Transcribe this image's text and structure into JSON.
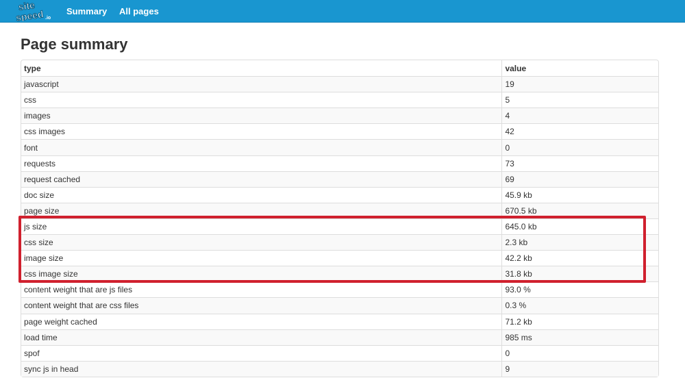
{
  "logo": {
    "text_top": "site",
    "text_bottom": "speed",
    "suffix": ".io"
  },
  "nav": {
    "summary": "Summary",
    "all_pages": "All pages"
  },
  "page_title": "Page summary",
  "table": {
    "headers": [
      "type",
      "value"
    ],
    "rows": [
      [
        "javascript",
        "19"
      ],
      [
        "css",
        "5"
      ],
      [
        "images",
        "4"
      ],
      [
        "css images",
        "42"
      ],
      [
        "font",
        "0"
      ],
      [
        "requests",
        "73"
      ],
      [
        "request cached",
        "69"
      ],
      [
        "doc size",
        "45.9 kb"
      ],
      [
        "page size",
        "670.5 kb"
      ],
      [
        "js size",
        "645.0 kb"
      ],
      [
        "css size",
        "2.3 kb"
      ],
      [
        "image size",
        "42.2 kb"
      ],
      [
        "css image size",
        "31.8 kb"
      ],
      [
        "content weight that are js files",
        "93.0 %"
      ],
      [
        "content weight that are css files",
        "0.3 %"
      ],
      [
        "page weight cached",
        "71.2 kb"
      ],
      [
        "load time",
        "985 ms"
      ],
      [
        "spof",
        "0"
      ],
      [
        "sync js in head",
        "9"
      ]
    ]
  },
  "colors": {
    "navbar": "#1996d0",
    "highlight": "#d0202e"
  }
}
